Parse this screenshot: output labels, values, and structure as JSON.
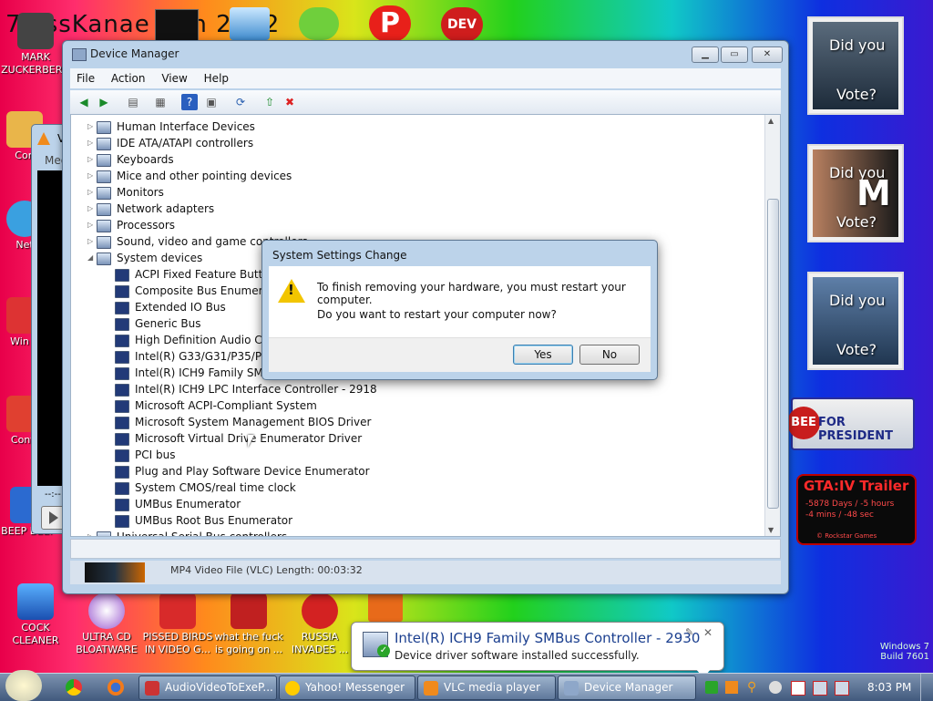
{
  "desktop": {
    "top_banner": "7 ossKanae tion 2012",
    "icons": [
      {
        "label": "MARK ZUCKERBERG"
      },
      {
        "label": "Con"
      },
      {
        "label": "Net"
      },
      {
        "label": "Win V"
      },
      {
        "label": "Contr"
      },
      {
        "label": "BEEP BEEP"
      },
      {
        "label": "COCK CLEANER"
      },
      {
        "label": "ULTRA CD BLOATWARE"
      },
      {
        "label": "PISSED BIRDS IN VIDEO G..."
      },
      {
        "label": "what the fuck is going on ..."
      },
      {
        "label": "RUSSIA INVADES ..."
      }
    ],
    "dev_icon_text": "DEV",
    "tiles": [
      {
        "line1": "Did you",
        "line2": "Vote?"
      },
      {
        "line1": "Did you",
        "line2": "Vote?",
        "overlay": "M"
      },
      {
        "line1": "Did you",
        "line2": "Vote?"
      }
    ],
    "president_banner": "FOR PRESIDENT",
    "president_badge": "BEE",
    "gta": {
      "title": "GTA:IV Trailer",
      "line1": "-5878 Days / -5 hours",
      "line2": "-4 mins / -48 sec",
      "footer": "© Rockstar Games"
    },
    "watermark": {
      "line1": "Windows 7",
      "line2": "Build 7601"
    }
  },
  "vlc_bg": {
    "title": "V",
    "menu": "Med",
    "time": "--:--",
    "file_info": "MP4 Video File (VLC)  Length: 00:03:32"
  },
  "device_manager": {
    "title": "Device Manager",
    "menu": [
      "File",
      "Action",
      "View",
      "Help"
    ],
    "tree": [
      {
        "label": "Human Interface Devices",
        "level": 0,
        "state": "collapsed"
      },
      {
        "label": "IDE ATA/ATAPI controllers",
        "level": 0,
        "state": "collapsed"
      },
      {
        "label": "Keyboards",
        "level": 0,
        "state": "collapsed"
      },
      {
        "label": "Mice and other pointing devices",
        "level": 0,
        "state": "collapsed"
      },
      {
        "label": "Monitors",
        "level": 0,
        "state": "collapsed"
      },
      {
        "label": "Network adapters",
        "level": 0,
        "state": "collapsed"
      },
      {
        "label": "Processors",
        "level": 0,
        "state": "collapsed"
      },
      {
        "label": "Sound, video and game controllers",
        "level": 0,
        "state": "collapsed"
      },
      {
        "label": "System devices",
        "level": 0,
        "state": "expanded"
      },
      {
        "label": "ACPI Fixed Feature Butto",
        "level": 1
      },
      {
        "label": "Composite Bus Enumer",
        "level": 1
      },
      {
        "label": "Extended IO Bus",
        "level": 1
      },
      {
        "label": "Generic Bus",
        "level": 1
      },
      {
        "label": "High Definition Audio C",
        "level": 1
      },
      {
        "label": "Intel(R) G33/G31/P35/P3",
        "level": 1
      },
      {
        "label": "Intel(R) ICH9 Family SM",
        "level": 1
      },
      {
        "label": "Intel(R) ICH9 LPC Interface Controller - 2918",
        "level": 1
      },
      {
        "label": "Microsoft ACPI-Compliant System",
        "level": 1
      },
      {
        "label": "Microsoft System Management BIOS Driver",
        "level": 1
      },
      {
        "label": "Microsoft Virtual Drive Enumerator Driver",
        "level": 1
      },
      {
        "label": "PCI bus",
        "level": 1
      },
      {
        "label": "Plug and Play Software Device Enumerator",
        "level": 1
      },
      {
        "label": "System CMOS/real time clock",
        "level": 1
      },
      {
        "label": "UMBus Enumerator",
        "level": 1
      },
      {
        "label": "UMBus Root Bus Enumerator",
        "level": 1
      },
      {
        "label": "Universal Serial Bus controllers",
        "level": 0,
        "state": "collapsed"
      }
    ]
  },
  "dialog": {
    "title": "System Settings Change",
    "message": "To finish removing your hardware, you must restart your computer.",
    "question": "Do you want to restart your computer now?",
    "yes": "Yes",
    "no": "No"
  },
  "balloon": {
    "title": "Intel(R) ICH9 Family SMBus Controller - 2930",
    "text": "Device driver software installed successfully."
  },
  "taskbar": {
    "tasks": [
      "AudioVideoToExeP...",
      "Yahoo! Messenger",
      "VLC media player",
      "Device Manager"
    ],
    "clock": "8:03 PM"
  },
  "colors": {
    "accent": "#3c7fb1",
    "warning": "#f2c500"
  }
}
